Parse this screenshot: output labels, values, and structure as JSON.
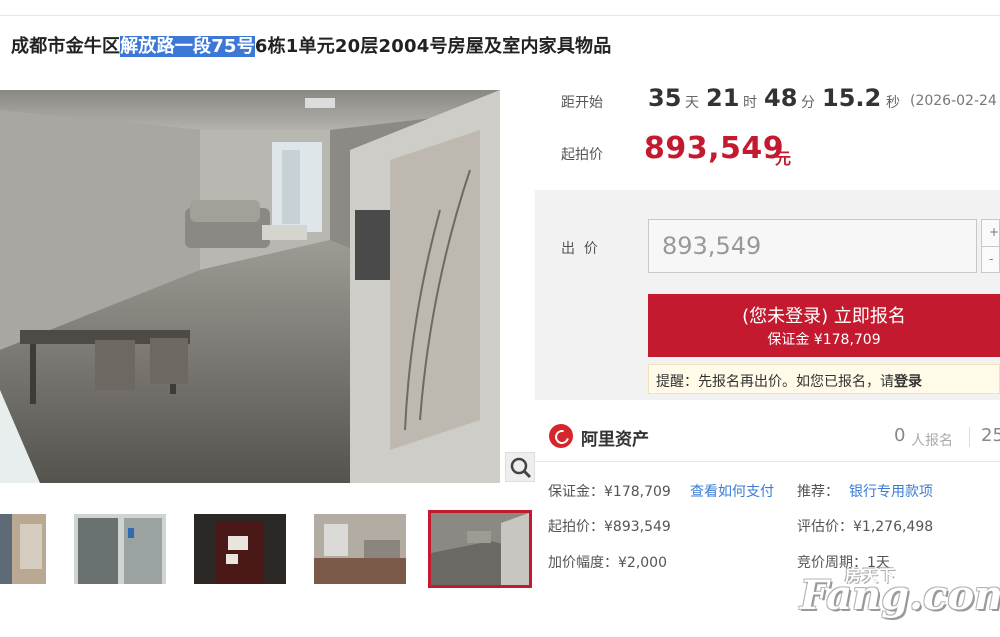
{
  "title": {
    "prefix": "成都市金牛区",
    "highlight": "解放路一段75号",
    "suffix": "6栋1单元20层2004号房屋及室内家具物品"
  },
  "countdown": {
    "label": "距开始",
    "days": "35",
    "days_unit": "天",
    "hours": "21",
    "hours_unit": "时",
    "minutes": "48",
    "minutes_unit": "分",
    "seconds": "15.2",
    "seconds_unit": "秒",
    "start_date": "(2026-02-24"
  },
  "start_price": {
    "label": "起拍价",
    "value": "893,549",
    "unit": "元"
  },
  "bid": {
    "label": "出  价",
    "input_value": "893,549",
    "stepper_up": "+",
    "stepper_down": "-"
  },
  "register_button": {
    "line1": "(您未登录) 立即报名",
    "line2": "保证金 ¥178,709"
  },
  "tip": {
    "text": "提醒：先报名再出价。如您已报名，请",
    "link": "登录"
  },
  "platform": {
    "name": "阿里资产",
    "registered_count": "0",
    "registered_label": "人报名",
    "views": "25"
  },
  "details": {
    "deposit": "保证金：¥178,709",
    "deposit_link": "查看如何支付",
    "recommend_label": "推荐：",
    "recommend_link": "银行专用款项",
    "start_price": "起拍价：¥893,549",
    "appraisal": "评估价：¥1,276,498",
    "increment": "加价幅度：¥2,000",
    "cycle": "竞价周期：1天"
  },
  "watermark": {
    "cn": "房天下",
    "en": "Fang.com"
  },
  "icons": {
    "zoom": "zoom-icon",
    "logo": "alibaba-asset-logo-icon"
  },
  "colors": {
    "accent_red": "#c41a2f",
    "link_blue": "#3a7bd5",
    "title_highlight": "#3c78d8"
  }
}
